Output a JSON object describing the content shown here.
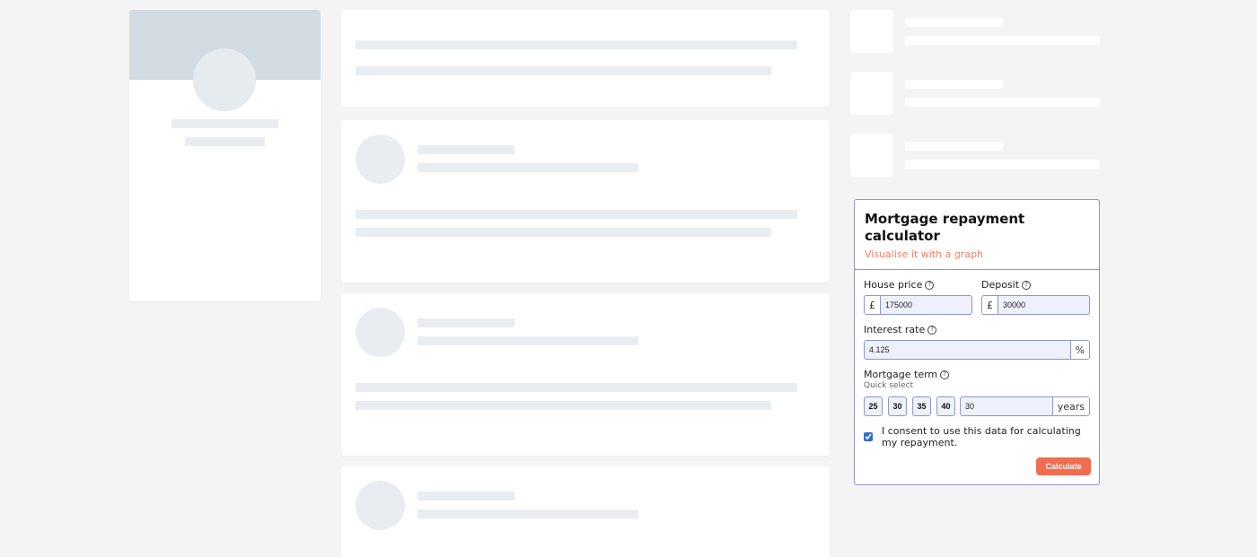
{
  "calculator": {
    "title": "Mortgage repayment calculator",
    "subtitle": "Visualise it with a graph",
    "house_price": {
      "label": "House price",
      "currency_symbol": "£",
      "value": "175000"
    },
    "deposit": {
      "label": "Deposit",
      "currency_symbol": "£",
      "value": "30000"
    },
    "interest_rate": {
      "label": "Interest rate",
      "value": "4.125",
      "unit": "%"
    },
    "mortgage_term": {
      "label": "Mortgage term",
      "hint": "Quick select",
      "quick_options": [
        "25",
        "30",
        "35",
        "40"
      ],
      "value": "30",
      "unit": "years"
    },
    "help_glyph": "?",
    "consent": {
      "label": "I consent to use this data for calculating my repayment.",
      "checked": true
    },
    "submit_label": "Calculate"
  },
  "colors": {
    "accent": "#f06d4f",
    "subtitle": "#ef8266",
    "border": "#8e96cf",
    "input_fill": "#eef0fb",
    "placeholder": "#e9edf1"
  },
  "icons": [
    "question-circle-icon"
  ]
}
